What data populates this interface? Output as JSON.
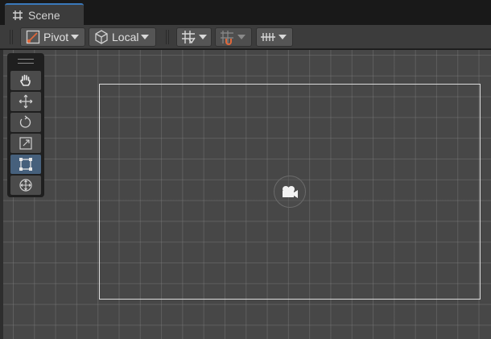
{
  "tab": {
    "label": "Scene",
    "icon": "grid-icon"
  },
  "toolbar": {
    "pivot_label": "Pivot",
    "local_label": "Local",
    "grid_snap_icon": "grid-snap-icon",
    "snap_icon": "magnet-snap-icon",
    "increment_snap_icon": "increment-snap-icon"
  },
  "tools": {
    "items": [
      "hand-tool",
      "move-tool",
      "rotate-tool",
      "scale-tool",
      "rect-tool",
      "transform-tool"
    ],
    "active": "rect-tool"
  },
  "colors": {
    "accent": "#3a79bb",
    "active_tool": "#46607c",
    "scene_bg": "#474747",
    "snap_accent": "#e0673a"
  }
}
